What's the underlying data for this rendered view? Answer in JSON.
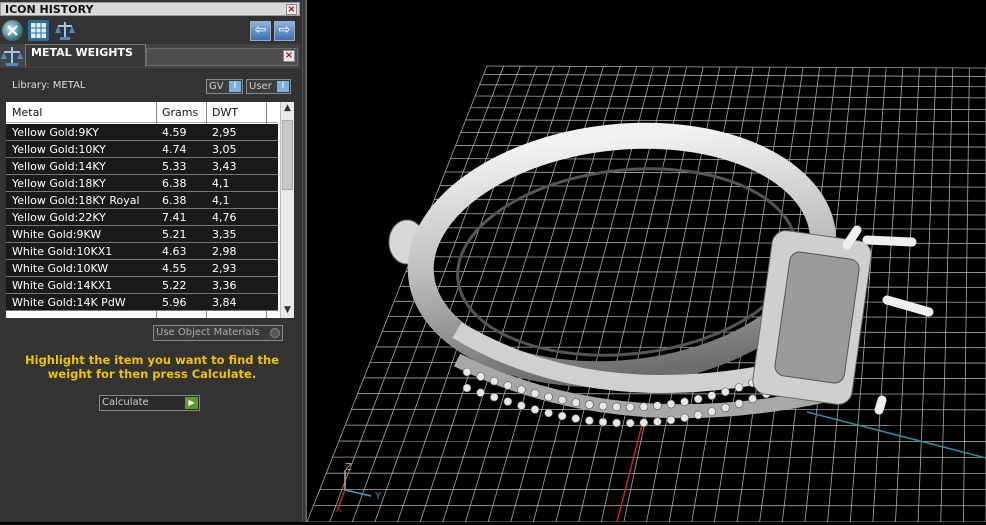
{
  "icon_history": {
    "title": "ICON HISTORY",
    "close_label": "×",
    "back_label": "⇦",
    "forward_label": "⇨"
  },
  "metal_weights": {
    "title": "METAL WEIGHTS",
    "close_label": "×",
    "library_label": "Library: METAL",
    "gv_label": "GV",
    "user_label": "User",
    "indicator_glyph": "I",
    "columns": [
      "Metal",
      "Grams",
      "DWT"
    ],
    "rows": [
      [
        "Yellow Gold:9KY",
        "4.59",
        "2,95"
      ],
      [
        "Yellow Gold:10KY",
        "4.74",
        "3,05"
      ],
      [
        "Yellow Gold:14KY",
        "5.33",
        "3,43"
      ],
      [
        "Yellow Gold:18KY",
        "6.38",
        "4,1"
      ],
      [
        "Yellow Gold:18KY Royal",
        "6.38",
        "4,1"
      ],
      [
        "Yellow Gold:22KY",
        "7.41",
        "4,76"
      ],
      [
        "White Gold:9KW",
        "5.21",
        "3,35"
      ],
      [
        "White Gold:10KX1",
        "4.63",
        "2,98"
      ],
      [
        "White Gold:10KW",
        "4.55",
        "2,93"
      ],
      [
        "White Gold:14KX1",
        "5.22",
        "3,36"
      ],
      [
        "White Gold:14K PdW",
        "5.96",
        "3,84"
      ]
    ],
    "use_object_materials_label": "Use Object Materials",
    "hint": "Highlight the item you want to find the weight for then press Calculate.",
    "calculate_label": "Calculate",
    "calculate_arrow": "▶",
    "scroll_up": "▲",
    "scroll_down": "▼"
  },
  "viewport": {
    "axis_z": "Z",
    "axis_y": "Y",
    "axis_x": "X",
    "grid_color": "#d0d0d0",
    "background": "#000000",
    "x_axis_color": "#cc2222",
    "y_axis_color": "#2a8fa8"
  },
  "colors": {
    "hint": "#f2c200",
    "panel": "#333333",
    "accent_blue": "#4f86c6"
  },
  "icons": [
    "tool-circle-icon",
    "document-grid-icon",
    "scale-icon",
    "back-arrow-icon",
    "forward-arrow-icon",
    "weight-scale-icon"
  ]
}
